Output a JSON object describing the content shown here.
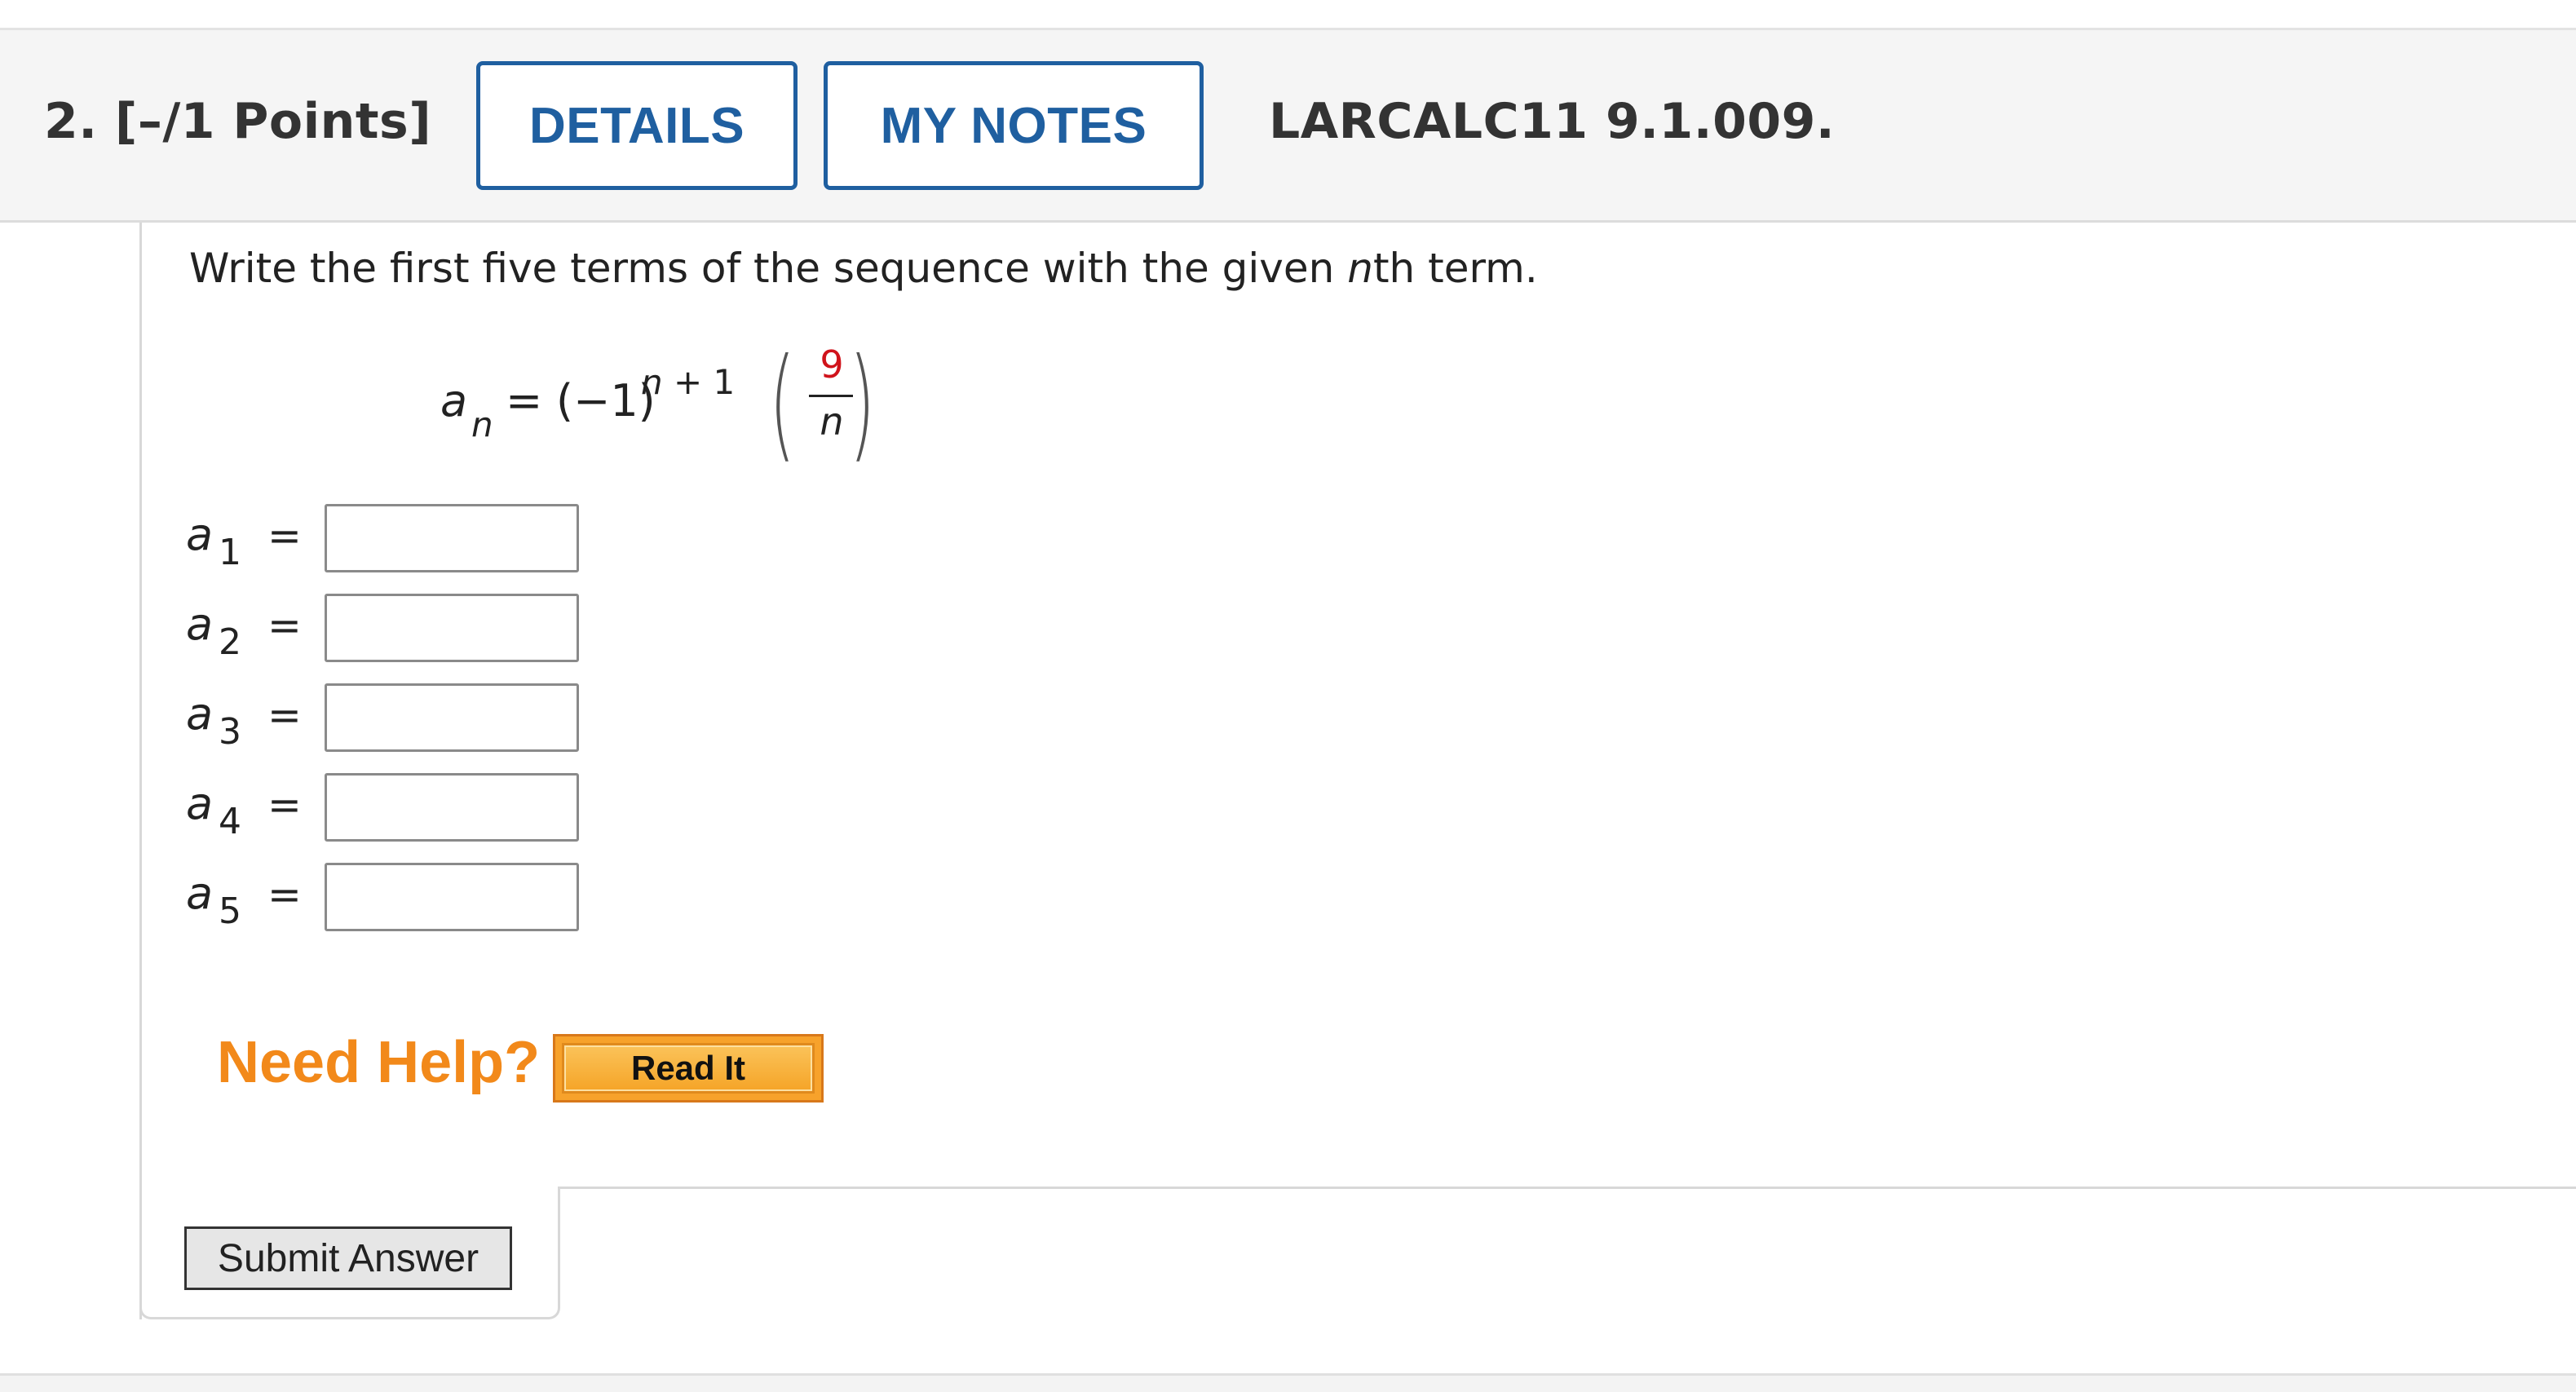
{
  "question": {
    "number_label": "2.  [–/1 Points]",
    "details_button": "DETAILS",
    "my_notes_button": "MY NOTES",
    "code": "LARCALC11 9.1.009."
  },
  "prompt": {
    "before": "Write the first five terms of the sequence with the given ",
    "italic": "n",
    "after": "th term."
  },
  "formula": {
    "lhs_var": "a",
    "lhs_sub": "n",
    "equals": "=",
    "base": "(−1)",
    "exp_var": "n",
    "exp_rest": " + 1",
    "numerator": "9",
    "denominator": "n",
    "left_paren": "(",
    "right_paren": ")"
  },
  "answers": [
    {
      "var": "a",
      "sub": "1",
      "eq": "=",
      "value": ""
    },
    {
      "var": "a",
      "sub": "2",
      "eq": "=",
      "value": ""
    },
    {
      "var": "a",
      "sub": "3",
      "eq": "=",
      "value": ""
    },
    {
      "var": "a",
      "sub": "4",
      "eq": "=",
      "value": ""
    },
    {
      "var": "a",
      "sub": "5",
      "eq": "=",
      "value": ""
    }
  ],
  "help": {
    "label": "Need Help?",
    "read_it_button": "Read It"
  },
  "submit_button": "Submit Answer",
  "colors": {
    "accent_blue": "#1f5fa0",
    "help_orange": "#f2891a",
    "numerator_red": "#d0131b"
  }
}
